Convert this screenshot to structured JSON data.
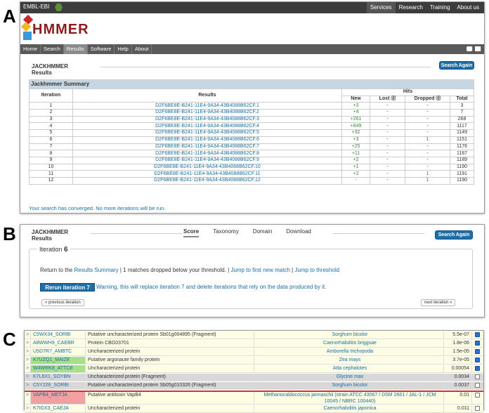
{
  "panel_labels": [
    "A",
    "B",
    "C"
  ],
  "header": {
    "brand": "EMBL-EBI",
    "top_nav": [
      "Services",
      "Research",
      "Training",
      "About us"
    ],
    "active_top": "Services"
  },
  "app": {
    "logo_text": "HMMER",
    "main_nav": [
      "Home",
      "Search",
      "Results",
      "Software",
      "Help",
      "About"
    ],
    "active_nav": "Results"
  },
  "panelA": {
    "title_line1": "JACKHMMER",
    "title_line2": "Results",
    "search_again": "Search Again",
    "summary_caption": "Jackhmmer Summary",
    "columns": {
      "iteration": "Iteration",
      "results": "Results",
      "hits": "Hits",
      "new": "New",
      "lost": "Lost",
      "dropped": "Dropped",
      "total": "Total"
    },
    "rows": [
      {
        "it": "1",
        "res": "D2F6BE8E-B241-11E4-9A34-43B4088B62CF.1",
        "new": "+3",
        "lost": "-",
        "dropped": "-",
        "total": "3"
      },
      {
        "it": "2",
        "res": "D2F6BE8E-B241-11E4-9A34-43B4088B62CF.2",
        "new": "+4",
        "lost": "-",
        "dropped": "-",
        "total": "7"
      },
      {
        "it": "3",
        "res": "D2F6BE8E-B241-11E4-9A34-43B4088B62CF.3",
        "new": "+261",
        "lost": "-",
        "dropped": "-",
        "total": "268"
      },
      {
        "it": "4",
        "res": "D2F6BE8E-B241-11E4-9A34-43B4088B62CF.4",
        "new": "+849",
        "lost": "-",
        "dropped": "-",
        "total": "1117"
      },
      {
        "it": "5",
        "res": "D2F6BE8E-B241-11E4-9A34-43B4088B62CF.5",
        "new": "+32",
        "lost": "-",
        "dropped": "-",
        "total": "1149"
      },
      {
        "it": "6",
        "res": "D2F6BE8E-B241-11E4-9A34-43B4088B62CF.6",
        "new": "+3",
        "lost": "-",
        "dropped": "1",
        "total": "1151"
      },
      {
        "it": "7",
        "res": "D2F6BE8E-B241-11E4-9A34-43B4088B62CF.7",
        "new": "+25",
        "lost": "-",
        "dropped": "-",
        "total": "1176"
      },
      {
        "it": "8",
        "res": "D2F6BE8E-B241-11E4-9A34-43B4088B62CF.8",
        "new": "+11",
        "lost": "-",
        "dropped": "-",
        "total": "1187"
      },
      {
        "it": "9",
        "res": "D2F6BE8E-B241-11E4-9A34-43B4088B62CF.9",
        "new": "+2",
        "lost": "-",
        "dropped": "-",
        "total": "1189"
      },
      {
        "it": "10",
        "res": "D2F6BE8E-B241-11E4-9A34-43B4088B62CF.10",
        "new": "+1",
        "lost": "-",
        "dropped": "-",
        "total": "1190"
      },
      {
        "it": "11",
        "res": "D2F6BE8E-B241-11E4-9A34-43B4088B62CF.11",
        "new": "+2",
        "lost": "-",
        "dropped": "1",
        "total": "1191"
      },
      {
        "it": "12",
        "res": "D2F6BE8E-B241-11E4-9A34-43B4088B62CF.12",
        "new": "-",
        "lost": "-",
        "dropped": "1",
        "total": "1190"
      }
    ],
    "converged": "Your search has converged. No more iterations will be run."
  },
  "panelB": {
    "title_line1": "JACKHMMER",
    "title_line2": "Results",
    "search_again": "Search Again",
    "tabs": [
      "Score",
      "Taxonomy",
      "Domain",
      "Download"
    ],
    "active_tab": "Score",
    "iteration_label": "Iteration",
    "iteration_number": "6",
    "line_prefix": "Return to the",
    "results_summary": "Results Summary",
    "dropped_text": "| 1 matches dropped below your threshold. |",
    "jump_new": "Jump to first new match",
    "sep": "|",
    "jump_threshold": "Jump to threshold",
    "rerun": "Rerun iteration 7",
    "warning": "Warning, this will replace iteration 7 and delete iterations that rely on the data produced by it.",
    "prev": "« previous iteration",
    "next": "next iteration »"
  },
  "panelC": {
    "rows": [
      {
        "acc": "C5WX34_SORBI",
        "desc": "Putative uncharacterized protein Sb01g004895 (Fragment)",
        "org": "Sorghum bicolor",
        "ev": "5.5e-07",
        "checked": true,
        "bg": "#fdfde4",
        "accbg": ""
      },
      {
        "acc": "A8WWH9_CAEBR",
        "desc": "Protein CBG03701",
        "org": "Caenorhabditis briggsae",
        "ev": "1.8e-06",
        "checked": true,
        "bg": "#fdfde4",
        "accbg": ""
      },
      {
        "acc": "U5D7R7_AMBTC",
        "desc": "Uncharacterized protein",
        "org": "Amborella trichopoda",
        "ev": "1.5e-05",
        "checked": true,
        "bg": "#fdfde4",
        "accbg": ""
      },
      {
        "acc": "K7UZQ1_MAIZE",
        "desc": "Putative argonaute family protein",
        "org": "Zea mays",
        "ev": "3.7e-05",
        "checked": true,
        "bg": "#fdfde4",
        "accbg": "#a8e08a"
      },
      {
        "acc": "W4WRK8_ATTCE",
        "desc": "Uncharacterized protein",
        "org": "Atta cephalotes",
        "ev": "0.00054",
        "checked": true,
        "bg": "#fdfde4",
        "accbg": "#a8e08a"
      },
      {
        "acc": "K7L6X1_SOYBN",
        "desc": "Uncharacterized protein (Fragment)",
        "org": "Glycine max",
        "ev": "0.0034",
        "checked": false,
        "bg": "#d8d8d8",
        "accbg": ""
      },
      {
        "acc": "C5Y228_SORBI",
        "desc": "Putative uncharacterized protein Sb05g010326 (Fragment)",
        "org": "Sorghum bicolor",
        "ev": "0.0037",
        "checked": false,
        "bg": "#d8d8d8",
        "accbg": ""
      },
      {
        "acc": "VAPB4_METJA",
        "desc": "Putative antitoxin VapB4",
        "org": "Methanocaldococcus jannaschii (strain ATCC 43067 / DSM 2661 / JAL-1 / JCM 10045 / NBRC 100440)",
        "ev": "0.01",
        "checked": false,
        "bg": "#fdfde4",
        "accbg": "#f2a0a0"
      },
      {
        "acc": "K7IGX3_CAEJA",
        "desc": "Uncharacterized protein",
        "org": "Caenorhabditis japonica",
        "ev": "0.011",
        "checked": false,
        "bg": "#fdfde4",
        "accbg": ""
      }
    ]
  }
}
